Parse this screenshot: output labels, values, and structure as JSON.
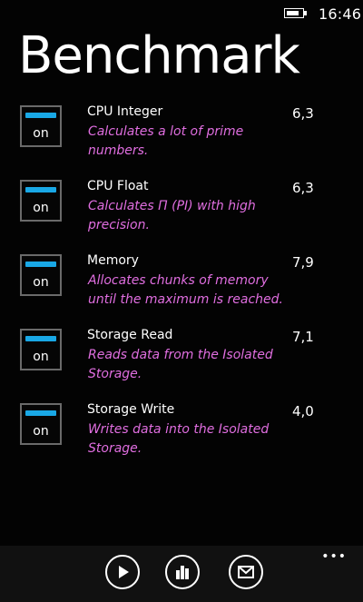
{
  "status_bar": {
    "time": "16:46",
    "battery_icon": "battery-charging-icon"
  },
  "title": "Benchmark",
  "tests": [
    {
      "name": "CPU Integer",
      "description": "Calculates a lot of prime numbers.",
      "score": "6,3",
      "toggle_label": "on",
      "enabled": true
    },
    {
      "name": "CPU Float",
      "description": "Calculates Π (PI) with high precision.",
      "score": "6,3",
      "toggle_label": "on",
      "enabled": true
    },
    {
      "name": "Memory",
      "description": "Allocates chunks of memory until the maximum is reached.",
      "score": "7,9",
      "toggle_label": "on",
      "enabled": true
    },
    {
      "name": "Storage Read",
      "description": "Reads data from the Isolated Storage.",
      "score": "7,1",
      "toggle_label": "on",
      "enabled": true
    },
    {
      "name": "Storage Write",
      "description": "Writes data into the Isolated Storage.",
      "score": "4,0",
      "toggle_label": "on",
      "enabled": true
    }
  ],
  "app_bar": {
    "buttons": [
      {
        "icon": "play-icon"
      },
      {
        "icon": "bar-chart-icon"
      },
      {
        "icon": "mail-icon"
      }
    ],
    "more_icon": "more-dots-icon"
  },
  "colors": {
    "accent": "#19a8e6",
    "description_text": "#e06ee0",
    "background": "#030303"
  }
}
